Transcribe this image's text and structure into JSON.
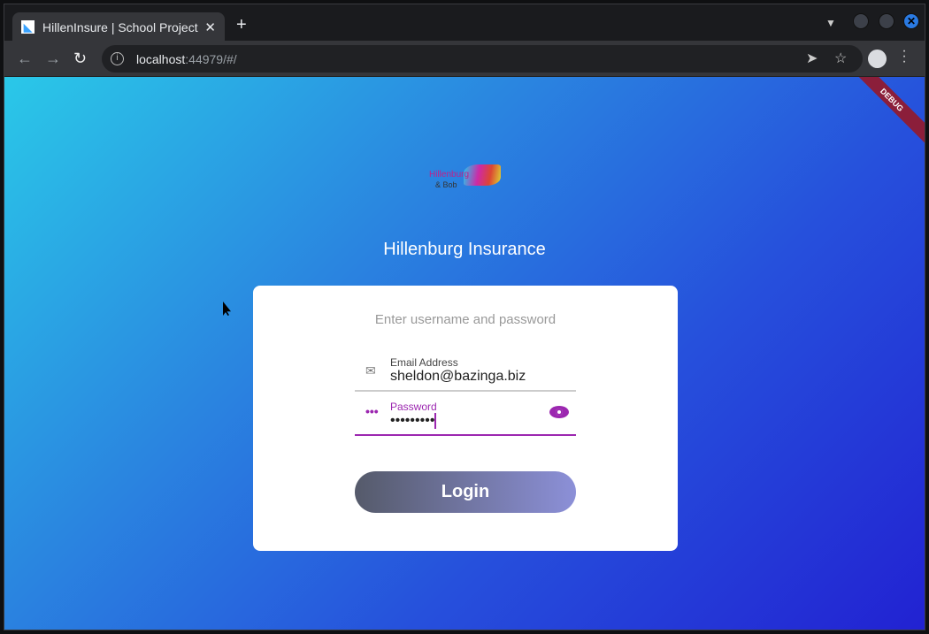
{
  "browser": {
    "tab_title": "HillenInsure | School Project",
    "tab_close": "✕",
    "new_tab": "+",
    "url_host": "localhost",
    "url_rest": ":44979/#/",
    "accent": "#2a7ae2"
  },
  "page": {
    "debug_banner": "DEBUG",
    "logo_text_1": "Hillenburg",
    "logo_text_2": "& Bob",
    "title": "Hillenburg Insurance",
    "prompt": "Enter username and password",
    "email": {
      "label": "Email Address",
      "value": "sheldon@bazinga.biz",
      "icon": "mail-icon"
    },
    "password": {
      "label": "Password",
      "value": "•••••••••",
      "icon": "password-icon",
      "toggle_icon": "eye-icon"
    },
    "login_label": "Login",
    "accent": "#9c27b0"
  }
}
